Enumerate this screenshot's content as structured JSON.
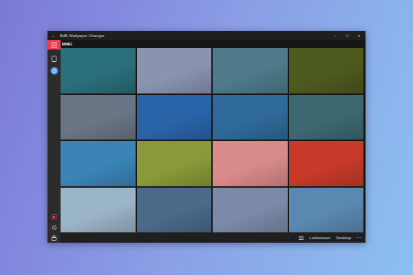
{
  "window": {
    "title": "BdB Wallpaper Changer",
    "back": "←",
    "controls": [
      "–",
      "□",
      "×"
    ]
  },
  "sidebar": {
    "items": [
      {
        "kind": "menu",
        "selected": false
      },
      {
        "kind": "tablet",
        "selected": false
      },
      {
        "kind": "globe",
        "selected": true
      }
    ],
    "footer": [
      {
        "kind": "favorite",
        "selected": false
      },
      {
        "kind": "gear",
        "selected": false
      },
      {
        "kind": "lock",
        "selected": false
      }
    ]
  },
  "header": "BING",
  "tiles": [
    {
      "color": "#2a6f7a"
    },
    {
      "color": "#8a93b0"
    },
    {
      "color": "#4e7a8a"
    },
    {
      "color": "#4d5a1e"
    },
    {
      "color": "#6a7585"
    },
    {
      "color": "#2a64a8"
    },
    {
      "color": "#2f6a9a"
    },
    {
      "color": "#3d6870"
    },
    {
      "color": "#3a84b8"
    },
    {
      "color": "#8a9a3a"
    },
    {
      "color": "#d98a8a"
    },
    {
      "color": "#c73a2a"
    },
    {
      "color": "#9ab4c8"
    },
    {
      "color": "#4a6a8a"
    },
    {
      "color": "#7a8aa8"
    },
    {
      "color": "#5a88b0"
    }
  ],
  "bottom_bar": {
    "buttons": [
      "Lockscreen",
      "Desktop"
    ],
    "more": "···"
  }
}
